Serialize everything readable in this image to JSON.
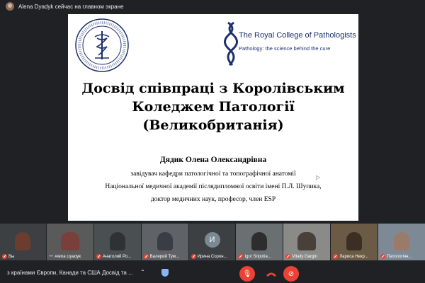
{
  "top_bar": {
    "presenter_text": "Alena Dyadyk сейчас на главном экране"
  },
  "slide": {
    "rcp_name": "The Royal College of Pathologists",
    "rcp_tagline": "Pathology: the science behind the cure",
    "title_lines": [
      "Досвід співпраці з Королівським",
      "Коледжем Патології",
      "(Великобританія)"
    ],
    "author": "Дядик Олена Олександрівна",
    "affiliation_lines": [
      "завідувач кафедри патологічної та топографічної анатомії",
      "Національної медичної академії післядипломної освіти імені П.Л. Шупика,",
      "доктор медичних наук, професор, член ESP"
    ]
  },
  "participants": [
    {
      "name": "Вы",
      "muted": true
    },
    {
      "name": "Alena Dyadyk",
      "muted": false,
      "speaking": true
    },
    {
      "name": "Анатолий Ро...",
      "muted": true
    },
    {
      "name": "Валерий Тум...",
      "muted": true
    },
    {
      "name": "Ирина Сорон...",
      "muted": true,
      "initial": "И"
    },
    {
      "name": "Igor Sripotia...",
      "muted": true
    },
    {
      "name": "Vitaliy Gargin",
      "muted": true
    },
    {
      "name": "Лариса Некр...",
      "muted": true
    },
    {
      "name": "Патологічн...",
      "muted": true
    }
  ],
  "bottom_bar": {
    "meeting_title": "з країнами Європи, Канади та США Досвід та ...",
    "icons": [
      "chevron-up-icon",
      "shield-icon",
      "mic-off-icon",
      "hang-up-icon",
      "camera-off-icon"
    ]
  },
  "colors": {
    "background": "#202124",
    "danger": "#ea4335",
    "rcp_navy": "#1c2f6e",
    "tile_bg": "#3c4043"
  }
}
